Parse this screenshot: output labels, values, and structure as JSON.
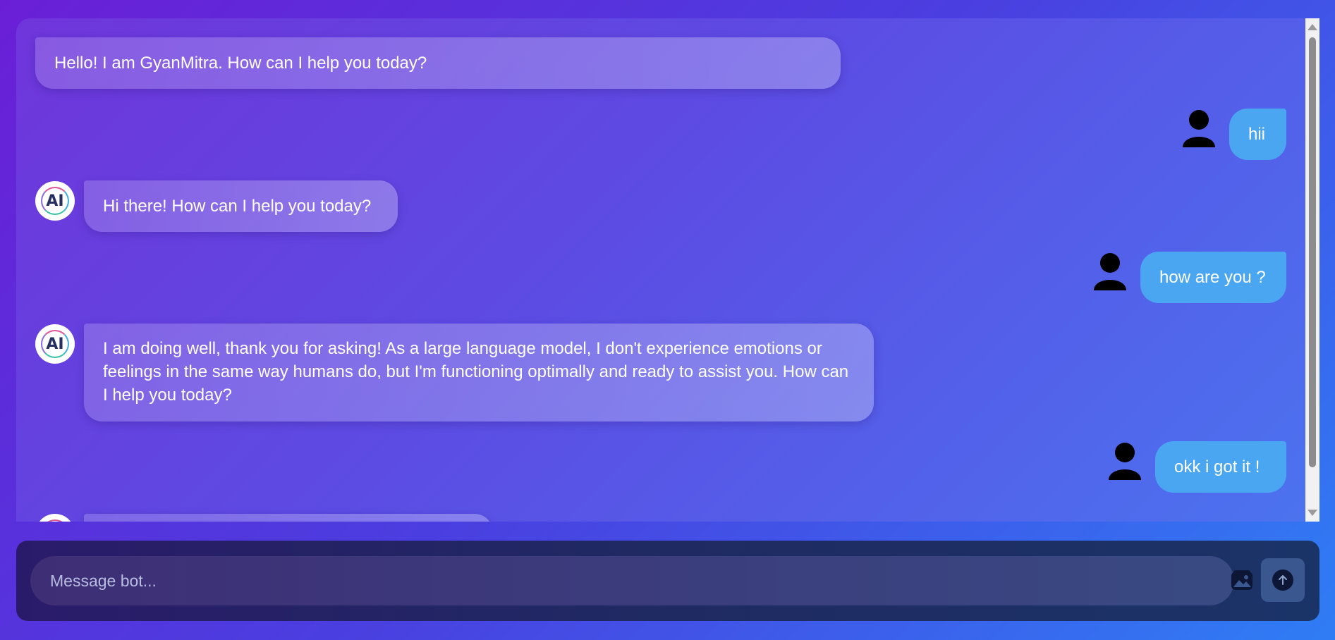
{
  "messages": [
    {
      "role": "bot",
      "text": "Hello! I am GyanMitra. How can I help you today?",
      "avatar": false
    },
    {
      "role": "user",
      "text": "hii"
    },
    {
      "role": "bot",
      "text": "Hi there! How can I help you today?",
      "avatar": true
    },
    {
      "role": "user",
      "text": "how are you ?"
    },
    {
      "role": "bot",
      "text": "I am doing well, thank you for asking! As a large language model, I don't experience emotions or feelings in the same way humans do, but I'm functioning optimally and ready to assist you. How can I help you today?",
      "avatar": true
    },
    {
      "role": "user",
      "text": "okk i got it !"
    }
  ],
  "bot_avatar_label": "AI",
  "composer": {
    "placeholder": "Message bot...",
    "value": ""
  },
  "icons": {
    "user_avatar": "user-silhouette-icon",
    "image_upload": "image-icon",
    "send": "arrow-up-icon"
  },
  "colors": {
    "user_bubble": "#4aa6f0",
    "send_button": "#3b5790"
  }
}
